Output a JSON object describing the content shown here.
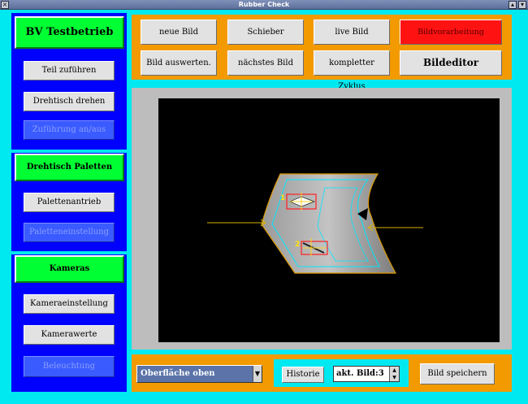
{
  "window": {
    "title": "Rubber Check"
  },
  "left": {
    "header_main": "BV Testbetrieb",
    "buttons_main": [
      {
        "label": "Teil zuführen",
        "enabled": true
      },
      {
        "label": "Drehtisch drehen",
        "enabled": true
      },
      {
        "label": "Zuführung an/aus",
        "enabled": false
      }
    ],
    "header_paletten": "Drehtisch Paletten",
    "buttons_paletten": [
      {
        "label": "Palettenantrieb",
        "enabled": true
      },
      {
        "label": "Paletteneinstellung",
        "enabled": false
      }
    ],
    "header_kameras": "Kameras",
    "buttons_kameras": [
      {
        "label": "Kameraeinstellung",
        "enabled": true
      },
      {
        "label": "Kamerawerte",
        "enabled": true
      },
      {
        "label": "Beleuchtung",
        "enabled": false
      }
    ]
  },
  "toolbar": {
    "row1": [
      "neue Bild",
      "Schieber",
      "live Bild",
      "Bildvorarbeitung schliessen"
    ],
    "row2": [
      "Bild auswerten.",
      "nächstes Bild",
      "kompletter Zyklus",
      "Bildeditor"
    ]
  },
  "viewer": {
    "marker1": "1",
    "marker2": "2"
  },
  "bottom": {
    "surface_select": "Oberfläche oben",
    "history_label": "Historie",
    "current_image": "akt. Bild:3",
    "save_label": "Bild speichern"
  },
  "colors": {
    "panel_blue": "#0000ff",
    "header_green": "#00ff33",
    "background_cyan": "#00e8f0",
    "toolbar_orange": "#f29a00",
    "close_red": "#ff1212"
  }
}
